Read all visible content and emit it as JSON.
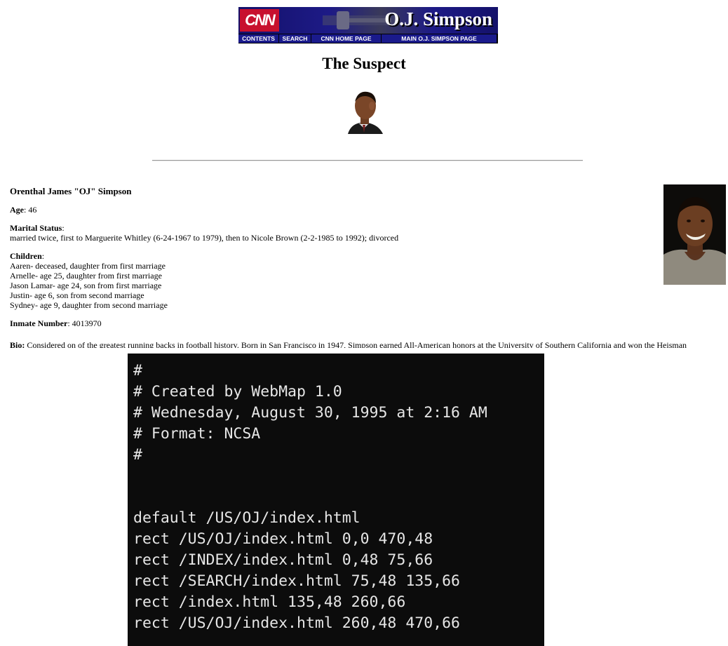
{
  "banner": {
    "logo_text": "CNN",
    "title": "O.J. Simpson",
    "nav": [
      "CONTENTS",
      "SEARCH",
      "CNN HOME PAGE",
      "MAIN O.J. SIMPSON PAGE"
    ]
  },
  "page_title": "The Suspect",
  "profile": {
    "name": "Orenthal James \"OJ\" Simpson",
    "age_label": "Age",
    "age_value": ": 46",
    "marital_label": "Marital Status",
    "marital_value": "married twice, first to Marguerite Whitley (6-24-1967 to 1979), then to Nicole Brown (2-2-1985 to 1992); divorced",
    "children_label": "Children",
    "children": [
      "Aaren- deceased, daughter from first marriage",
      "Arnelle- age 25, daughter from first marriage",
      "Jason Lamar- age 24, son from first marriage",
      "Justin- age 6, son from second marriage",
      "Sydney- age 9, daughter from second marriage"
    ],
    "inmate_label": "Inmate Number",
    "inmate_value": ": 4013970",
    "bio_label": "Bio:",
    "bio_value": " Considered on of the greatest running backs in football history. Born in San Francisco in 1947, Simpson earned All-American honors at the University of Southern California and won the Heisman"
  },
  "code": [
    "#",
    "# Created by WebMap 1.0",
    "# Wednesday, August 30, 1995 at 2:16 AM",
    "# Format: NCSA",
    "#",
    "",
    "",
    "default /US/OJ/index.html",
    "rect /US/OJ/index.html 0,0 470,48",
    "rect /INDEX/index.html 0,48 75,66",
    "rect /SEARCH/index.html 75,48 135,66",
    "rect /index.html 135,48 260,66",
    "rect /US/OJ/index.html 260,48 470,66"
  ]
}
